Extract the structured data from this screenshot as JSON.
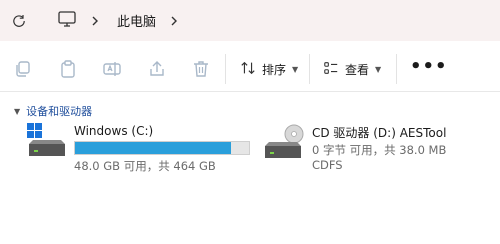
{
  "breadcrumb": {
    "location": "此电脑"
  },
  "toolbar": {
    "sort_label": "排序",
    "view_label": "查看",
    "more_label": "•••"
  },
  "section": {
    "title": "设备和驱动器"
  },
  "drives": [
    {
      "name": "Windows (C:)",
      "space_text": "48.0 GB 可用，共 464 GB",
      "used_fraction": 0.897
    },
    {
      "name": "CD 驱动器 (D:) AESTool",
      "space_text": "0 字节 可用，共 38.0 MB",
      "filesystem": "CDFS"
    }
  ],
  "colors": {
    "accent": "#2a9fdb",
    "section_text": "#1f4e9c",
    "addressbar_bg": "#f8f1f1"
  }
}
